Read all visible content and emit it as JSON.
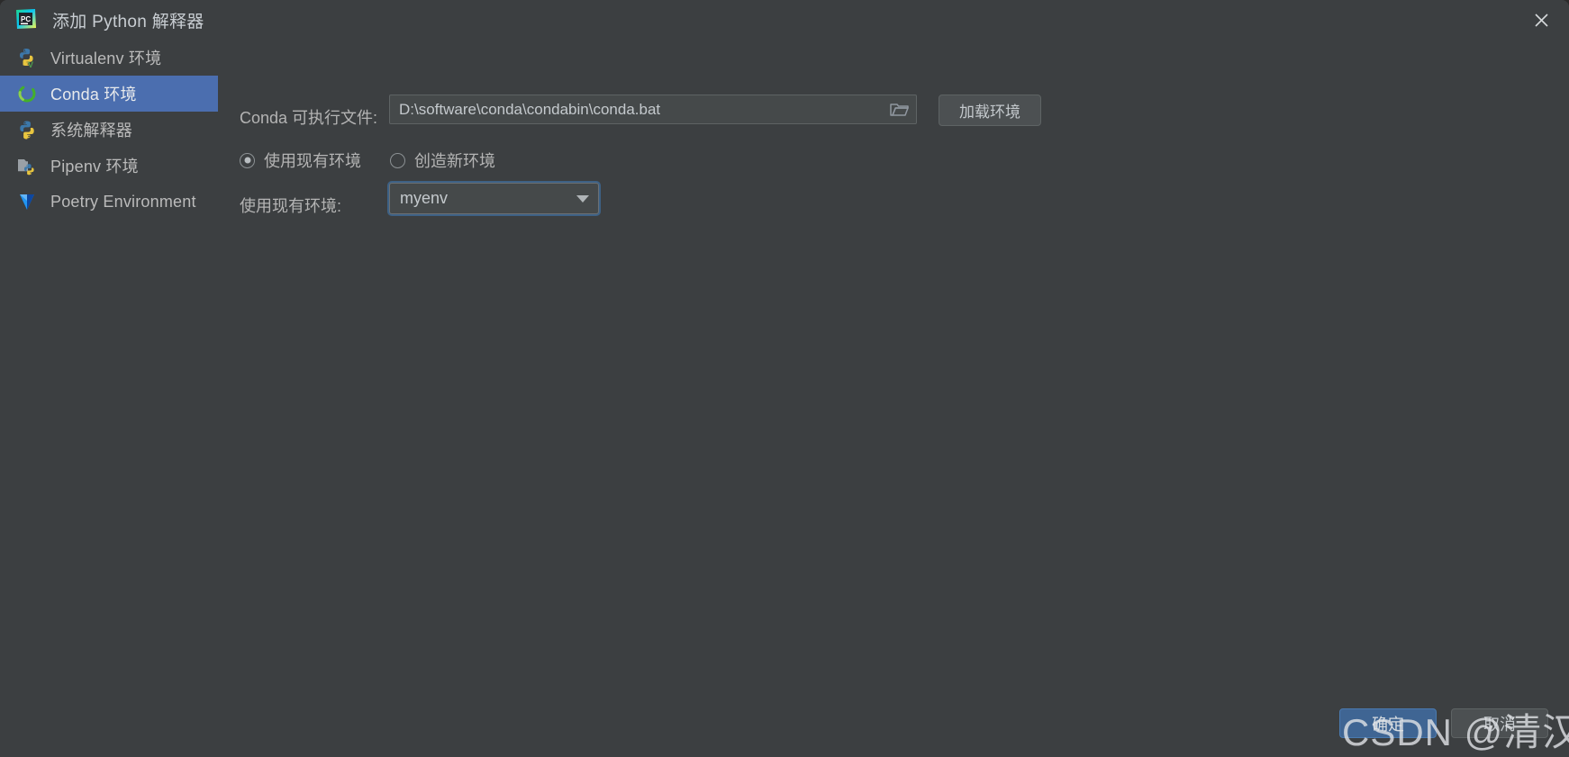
{
  "window": {
    "title": "添加 Python 解释器",
    "app_icon": "pycharm-logo-icon",
    "close_icon": "close-icon",
    "background_color": "#3c3f41",
    "accent_color": "#4b6eaf"
  },
  "sidebar": {
    "items": [
      {
        "label": "Virtualenv 环境",
        "icon": "python-virtualenv-icon",
        "selected": false
      },
      {
        "label": "Conda 环境",
        "icon": "conda-icon",
        "selected": true
      },
      {
        "label": "系统解释器",
        "icon": "python-icon",
        "selected": false
      },
      {
        "label": "Pipenv 环境",
        "icon": "pipenv-folder-icon",
        "selected": false
      },
      {
        "label": "Poetry Environment",
        "icon": "poetry-icon",
        "selected": false
      }
    ]
  },
  "main": {
    "executable": {
      "label": "Conda 可执行文件:",
      "value": "D:\\software\\conda\\condabin\\conda.bat",
      "placeholder": "",
      "browse_icon": "folder-open-icon"
    },
    "load_button": "加载环境",
    "mode_options": [
      {
        "label": "使用现有环境",
        "checked": true
      },
      {
        "label": "创造新环境",
        "checked": false
      }
    ],
    "existing_env": {
      "label": "使用现有环境:",
      "value": "myenv",
      "dropdown_icon": "chevron-down-icon"
    }
  },
  "footer": {
    "ok_label": "确定",
    "cancel_label": "取消"
  },
  "watermark": {
    "text": "CSDN @清汉"
  }
}
